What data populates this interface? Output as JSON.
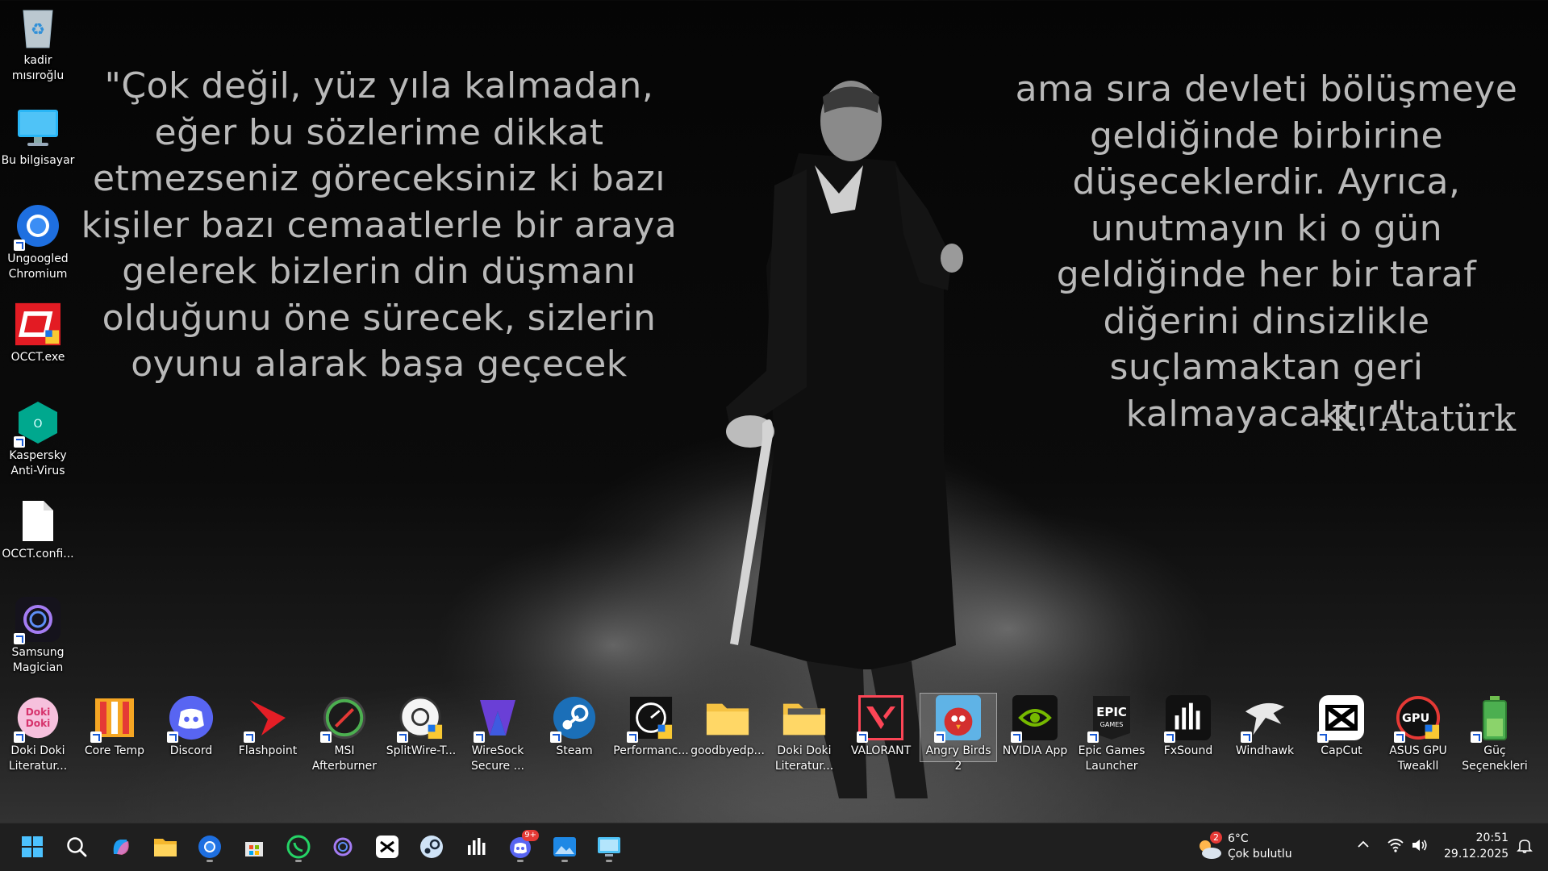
{
  "wallpaper": {
    "quote_left": "\"Çok değil, yüz yıla kalmadan, eğer bu sözlerime dikkat etmezseniz göreceksiniz ki bazı kişiler bazı cemaatlerle bir araya gelerek bizlerin din düşmanı olduğunu öne sürecek, sizlerin oyunu alarak başa geçecek",
    "quote_right": "ama sıra devleti bölüşmeye geldiğinde birbirine düşeceklerdir. Ayrıca, unutmayın ki o gün geldiğinde her bir taraf diğerini dinsizlikle suçlamaktan geri kalmayacaktır.\"",
    "signature": "-K. Atatürk"
  },
  "desktop": {
    "left_column": [
      {
        "label": "kadir mısıroğlu",
        "icon": "recycle-bin-icon"
      },
      {
        "label": "Bu bilgisayar",
        "icon": "monitor-icon"
      },
      {
        "label": "Ungoogled Chromium",
        "icon": "chromium-icon"
      },
      {
        "label": "OCCT.exe",
        "icon": "occt-icon"
      },
      {
        "label": "Kaspersky Anti-Virus",
        "icon": "kaspersky-icon"
      },
      {
        "label": "OCCT.confi...",
        "icon": "file-icon"
      },
      {
        "label": "Samsung Magician",
        "icon": "samsung-magician-icon"
      }
    ],
    "bottom_row": [
      {
        "label": "Doki Doki Literatur...",
        "icon": "doki-doki-icon"
      },
      {
        "label": "Core Temp",
        "icon": "core-temp-icon"
      },
      {
        "label": "Discord",
        "icon": "discord-icon"
      },
      {
        "label": "Flashpoint",
        "icon": "flashpoint-icon"
      },
      {
        "label": "MSI Afterburner",
        "icon": "msi-afterburner-icon"
      },
      {
        "label": "SplitWire-T...",
        "icon": "splitwire-icon"
      },
      {
        "label": "WireSock Secure ...",
        "icon": "wiresock-icon"
      },
      {
        "label": "Steam",
        "icon": "steam-icon"
      },
      {
        "label": "Performanc...",
        "icon": "performance-icon"
      },
      {
        "label": "goodbyedp...",
        "icon": "folder-icon"
      },
      {
        "label": "Doki Doki Literatur...",
        "icon": "folder-images-icon"
      },
      {
        "label": "VALORANT",
        "icon": "valorant-icon"
      },
      {
        "label": "Angry Birds 2",
        "icon": "angry-birds-icon"
      },
      {
        "label": "NVIDIA App",
        "icon": "nvidia-icon"
      },
      {
        "label": "Epic Games Launcher",
        "icon": "epic-games-icon"
      },
      {
        "label": "FxSound",
        "icon": "fxsound-icon"
      },
      {
        "label": "Windhawk",
        "icon": "windhawk-icon"
      },
      {
        "label": "CapCut",
        "icon": "capcut-icon"
      },
      {
        "label": "ASUS GPU Tweakll",
        "icon": "asus-gpu-tweak-icon"
      },
      {
        "label": "Güç Seçenekleri",
        "icon": "battery-icon"
      }
    ],
    "selected_item": "Angry Birds 2"
  },
  "taskbar": {
    "apps": [
      "start-icon",
      "search-icon",
      "copilot-icon",
      "file-explorer-icon",
      "chromium-icon",
      "store-icon",
      "whatsapp-icon",
      "samsung-magician-icon",
      "capcut-icon",
      "steam-icon",
      "fxsound-icon",
      "discord-icon",
      "photos-icon",
      "remote-desktop-icon"
    ],
    "discord_badge": "9+",
    "weather": {
      "badge": "2",
      "temp": "6°C",
      "desc": "Çok bulutlu"
    },
    "clock": {
      "time": "20:51",
      "date": "29.12.2025"
    }
  }
}
